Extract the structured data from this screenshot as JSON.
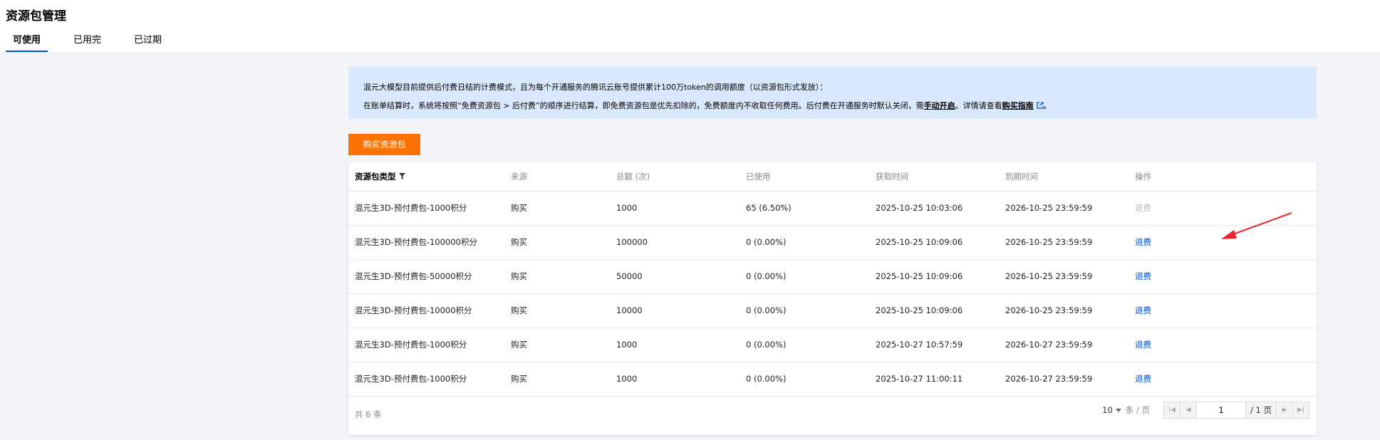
{
  "page": {
    "title": "资源包管理",
    "tabs": [
      {
        "label": "可使用",
        "active": true
      },
      {
        "label": "已用完",
        "active": false
      },
      {
        "label": "已过期",
        "active": false
      }
    ]
  },
  "notice": {
    "line1": "混元大模型目前提供后付费日结的计费模式，且为每个开通服务的腾讯云账号提供累计100万token的调用额度（以资源包形式发放）：",
    "line2_prefix": "在账单结算时，系统将按照“免费资源包 > 后付费”的顺序进行结算，即免费资源包是优先扣除的，免费额度内不收取任何费用。后付费在开通服务时默认关闭，需",
    "line2_link1": "手动开启",
    "line2_mid": "。详情请查看",
    "line2_link2": "购买指南",
    "line2_suffix": "。"
  },
  "buy_button": "购买资源包",
  "table": {
    "headers": [
      "资源包类型",
      "来源",
      "总额 (次)",
      "已使用",
      "获取时间",
      "到期时间",
      "操作"
    ],
    "rows": [
      {
        "type": "混元生3D-预付费包-1000积分",
        "source": "购买",
        "total": "1000",
        "used": "65 (6.50%)",
        "acquired": "2025-10-25 10:03:06",
        "expires": "2026-10-25 23:59:59",
        "action": "退费",
        "action_disabled": true
      },
      {
        "type": "混元生3D-预付费包-100000积分",
        "source": "购买",
        "total": "100000",
        "used": "0 (0.00%)",
        "acquired": "2025-10-25 10:09:06",
        "expires": "2026-10-25 23:59:59",
        "action": "退费",
        "action_disabled": false
      },
      {
        "type": "混元生3D-预付费包-50000积分",
        "source": "购买",
        "total": "50000",
        "used": "0 (0.00%)",
        "acquired": "2025-10-25 10:09:06",
        "expires": "2026-10-25 23:59:59",
        "action": "退费",
        "action_disabled": false
      },
      {
        "type": "混元生3D-预付费包-10000积分",
        "source": "购买",
        "total": "10000",
        "used": "0 (0.00%)",
        "acquired": "2025-10-25 10:09:06",
        "expires": "2026-10-25 23:59:59",
        "action": "退费",
        "action_disabled": false
      },
      {
        "type": "混元生3D-预付费包-1000积分",
        "source": "购买",
        "total": "1000",
        "used": "0 (0.00%)",
        "acquired": "2025-10-27 10:57:59",
        "expires": "2026-10-27 23:59:59",
        "action": "退费",
        "action_disabled": false
      },
      {
        "type": "混元生3D-预付费包-1000积分",
        "source": "购买",
        "total": "1000",
        "used": "0 (0.00%)",
        "acquired": "2025-10-27 11:00:11",
        "expires": "2026-10-27 23:59:59",
        "action": "退费",
        "action_disabled": false
      }
    ]
  },
  "footer": {
    "total": "共 6 条",
    "page_size": "10",
    "page_size_unit": "条 / 页",
    "current_page": "1",
    "total_pages": "/ 1 页"
  },
  "colors": {
    "accent": "#0052d9",
    "buy_button": "#ff7200",
    "notice_bg": "#d9e8fd",
    "annotation_arrow": "#e8262c"
  }
}
